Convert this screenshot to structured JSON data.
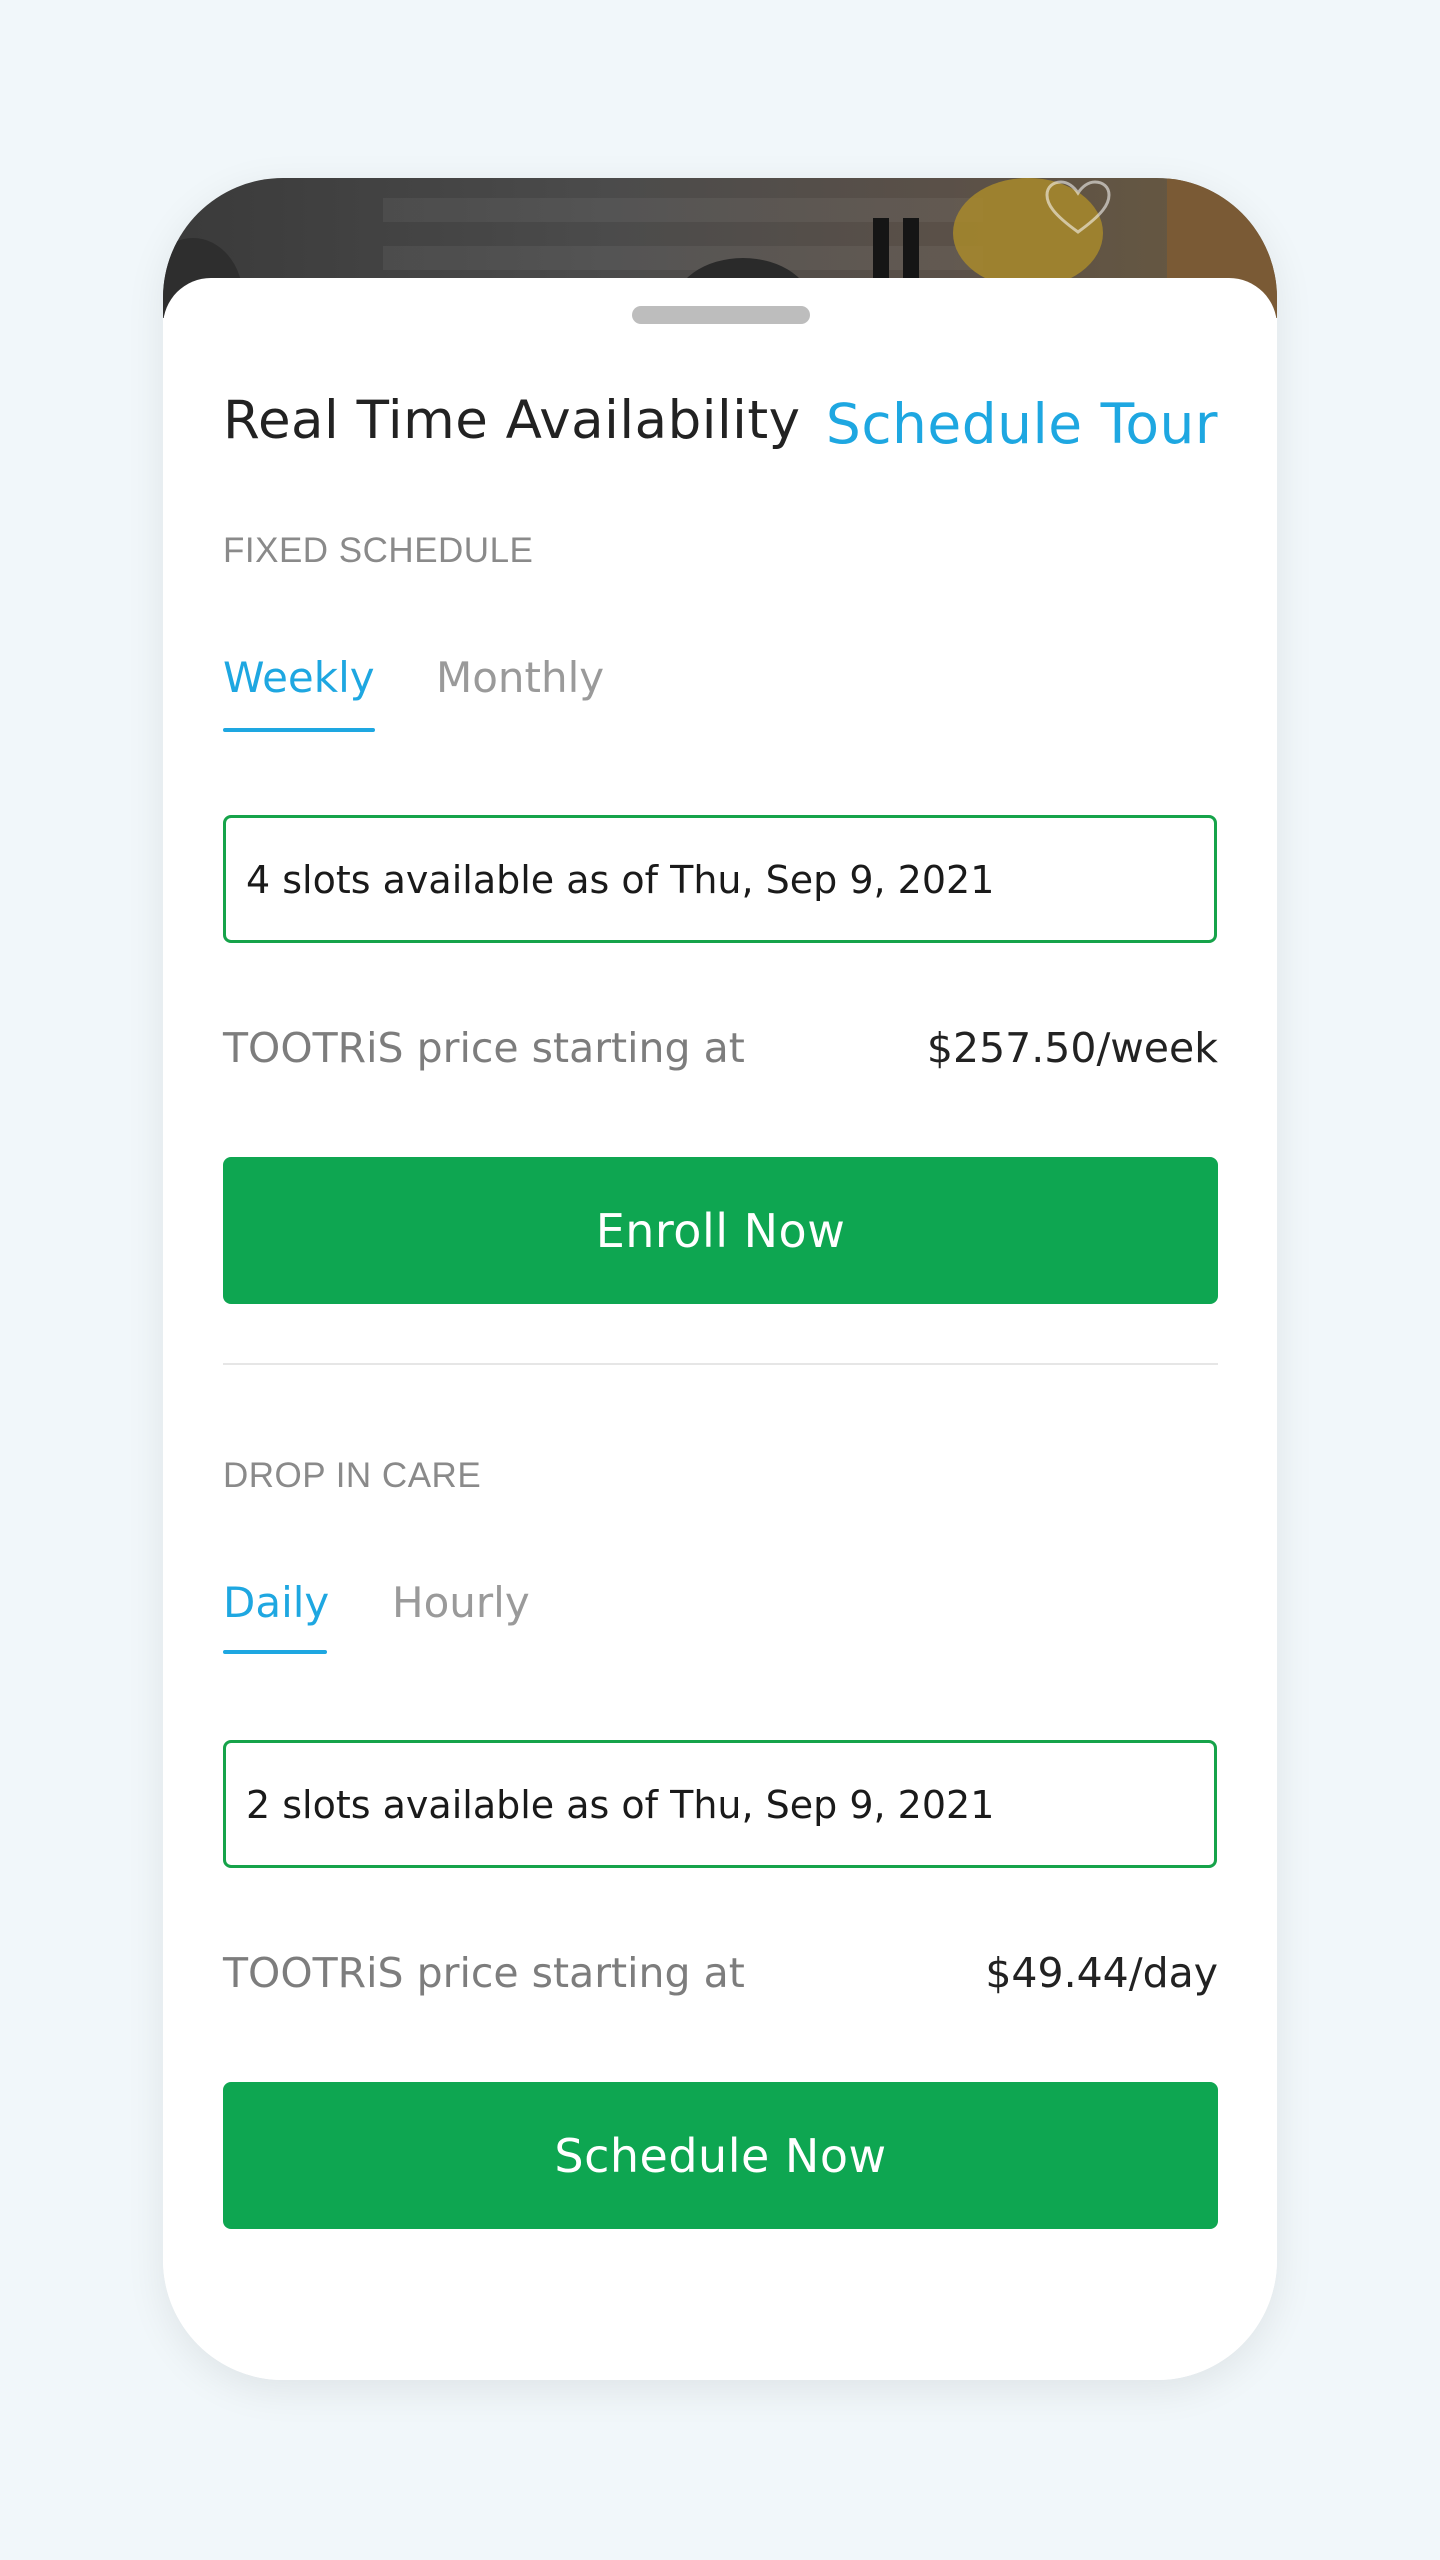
{
  "header": {
    "title": "Real Time Availability",
    "schedule_tour_label": "Schedule Tour"
  },
  "fixed_schedule": {
    "section_label": "FIXED SCHEDULE",
    "tabs": [
      {
        "label": "Weekly",
        "active": true
      },
      {
        "label": "Monthly",
        "active": false
      }
    ],
    "slots_text": "4 slots available as of Thu, Sep 9, 2021",
    "price_label": "TOOTRiS price starting at",
    "price_value": "$257.50/week",
    "cta_label": "Enroll Now"
  },
  "drop_in_care": {
    "section_label": "DROP IN CARE",
    "tabs": [
      {
        "label": "Daily",
        "active": true
      },
      {
        "label": "Hourly",
        "active": false
      }
    ],
    "slots_text": "2 slots available as of Thu, Sep 9, 2021",
    "price_label": "TOOTRiS price starting at",
    "price_value": "$49.44/day",
    "cta_label": "Schedule Now"
  },
  "colors": {
    "accent_blue": "#1ea7e1",
    "brand_green": "#0ea651",
    "background": "#f1f7fa"
  },
  "icons": {
    "favorite": "heart-icon"
  }
}
